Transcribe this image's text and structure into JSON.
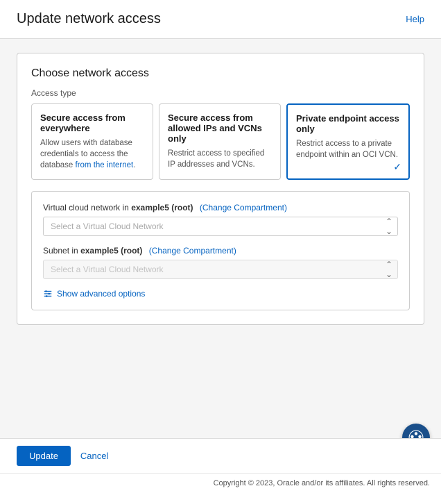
{
  "page": {
    "title": "Update network access",
    "help_link": "Help"
  },
  "card": {
    "title": "Choose network access",
    "access_type_label": "Access type",
    "access_options": [
      {
        "id": "everywhere",
        "title": "Secure access from everywhere",
        "description": "Allow users with database credentials to access the database from the internet.",
        "selected": false
      },
      {
        "id": "allowed_ips",
        "title": "Secure access from allowed IPs and VCNs only",
        "description": "Restrict access to specified IP addresses and VCNs.",
        "selected": false
      },
      {
        "id": "private_endpoint",
        "title": "Private endpoint access only",
        "description": "Restrict access to a private endpoint within an OCI VCN.",
        "selected": true
      }
    ],
    "vcn_section": {
      "vcn_label": "Virtual cloud network in",
      "vcn_compartment": "example5 (root)",
      "vcn_change_compartment": "(Change Compartment)",
      "vcn_placeholder": "Select a Virtual Cloud Network",
      "subnet_label": "Subnet in",
      "subnet_compartment": "example5 (root)",
      "subnet_change_compartment": "(Change Compartment)",
      "subnet_placeholder": "Select a Virtual Cloud Network",
      "advanced_options_label": "Show advanced options"
    }
  },
  "actions": {
    "update_label": "Update",
    "cancel_label": "Cancel"
  },
  "copyright": {
    "text": "Copyright © 2023, Oracle and/or its affiliates. All rights reserved."
  }
}
